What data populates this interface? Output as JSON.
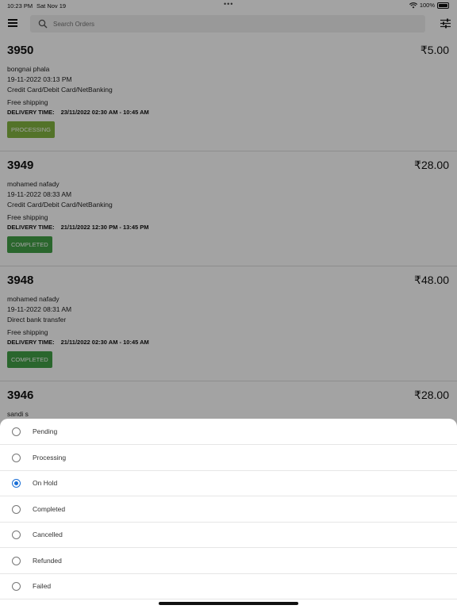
{
  "status_bar": {
    "time": "10:23 PM",
    "date": "Sat Nov 19",
    "battery": "100%"
  },
  "search": {
    "placeholder": "Search Orders"
  },
  "icons": {
    "menu": "hamburger-menu-icon",
    "search": "search-icon",
    "filter": "filter-sliders-icon",
    "wifi": "wifi-icon",
    "battery": "battery-icon"
  },
  "colors": {
    "processing_badge": "#82b541",
    "completed_badge": "#43a047",
    "radio_selected": "#1a6fd6"
  },
  "orders": [
    {
      "number": "3950",
      "price": "₹5.00",
      "customer": "bongnai phala",
      "datetime": "19-11-2022  03:13 PM",
      "payment": "Credit Card/Debit Card/NetBanking",
      "shipping": "Free shipping",
      "delivery_label": "DELIVERY TIME:",
      "delivery_value": "23/11/2022  02:30 AM - 10:45 AM",
      "status": "PROCESSING"
    },
    {
      "number": "3949",
      "price": "₹28.00",
      "customer": "mohamed nafady",
      "datetime": "19-11-2022  08:33 AM",
      "payment": "Credit Card/Debit Card/NetBanking",
      "shipping": "Free shipping",
      "delivery_label": "DELIVERY TIME:",
      "delivery_value": "21/11/2022  12:30 PM - 13:45 PM",
      "status": "COMPLETED"
    },
    {
      "number": "3948",
      "price": "₹48.00",
      "customer": "mohamed nafady",
      "datetime": "19-11-2022  08:31 AM",
      "payment": "Direct bank transfer",
      "shipping": "Free shipping",
      "delivery_label": "DELIVERY TIME:",
      "delivery_value": "21/11/2022  02:30 AM - 10:45 AM",
      "status": "COMPLETED"
    },
    {
      "number": "3946",
      "price": "₹28.00",
      "customer": "sandi s"
    }
  ],
  "status_sheet": {
    "options": [
      {
        "label": "Pending",
        "selected": false
      },
      {
        "label": "Processing",
        "selected": false
      },
      {
        "label": "On Hold",
        "selected": true
      },
      {
        "label": "Completed",
        "selected": false
      },
      {
        "label": "Cancelled",
        "selected": false
      },
      {
        "label": "Refunded",
        "selected": false
      },
      {
        "label": "Failed",
        "selected": false
      }
    ]
  }
}
